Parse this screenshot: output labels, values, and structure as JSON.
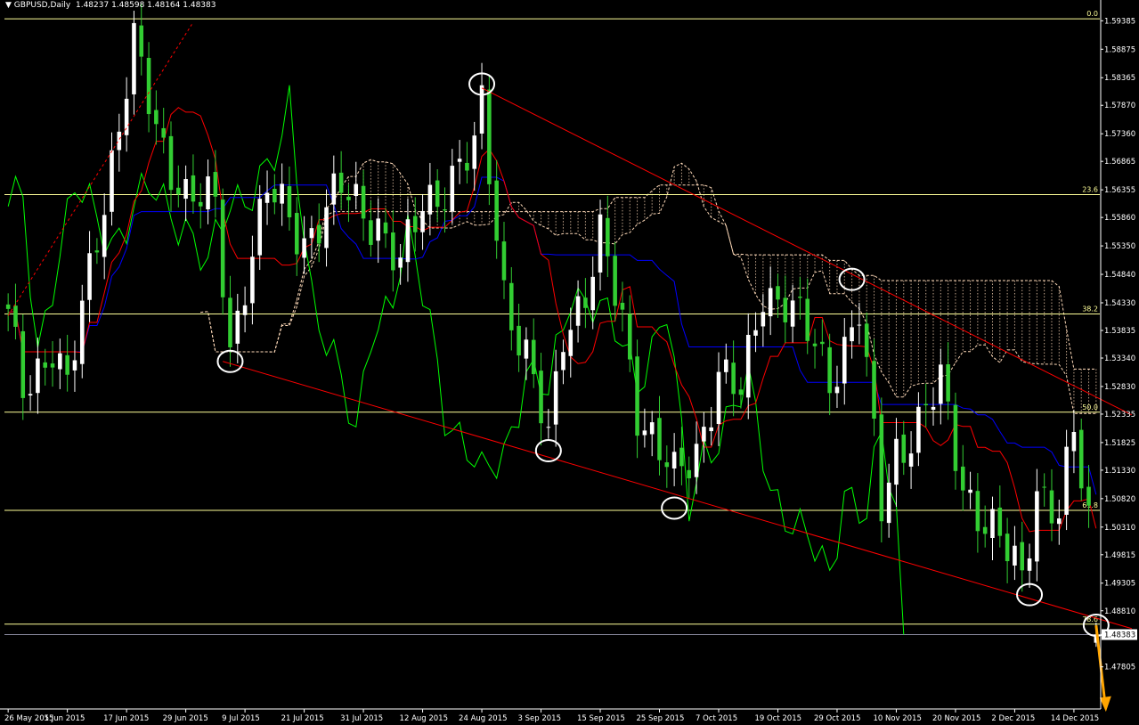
{
  "header": {
    "symbol_label": "GBPUSD,Daily",
    "ohlc": [
      "1.48237",
      "1.48598",
      "1.48164",
      "1.48383"
    ]
  },
  "chart_data": {
    "type": "candlestick",
    "ylim": [
      1.4705,
      1.5955
    ],
    "y_ticks": [
      "1.59385",
      "1.58875",
      "1.58365",
      "1.57870",
      "1.57360",
      "1.56865",
      "1.56355",
      "1.55860",
      "1.55350",
      "1.54840",
      "1.54330",
      "1.53835",
      "1.53340",
      "1.52830",
      "1.52335",
      "1.51825",
      "1.51330",
      "1.50820",
      "1.50310",
      "1.49815",
      "1.49305",
      "1.48810",
      "1.48383",
      "1.47805"
    ],
    "x_ticks": [
      "26 May 2015",
      "5 Jun 2015",
      "17 Jun 2015",
      "29 Jun 2015",
      "9 Jul 2015",
      "21 Jul 2015",
      "31 Jul 2015",
      "12 Aug 2015",
      "24 Aug 2015",
      "3 Sep 2015",
      "15 Sep 2015",
      "25 Sep 2015",
      "7 Oct 2015",
      "19 Oct 2015",
      "29 Oct 2015",
      "10 Nov 2015",
      "20 Nov 2015",
      "2 Dec 2015",
      "14 Dec 2015"
    ],
    "current_price": "1.48383",
    "fib_levels": [
      {
        "label": "0.0",
        "price": 1.5942
      },
      {
        "label": "23.6",
        "price": 1.5627
      },
      {
        "label": "38.2",
        "price": 1.5413
      },
      {
        "label": "50.0",
        "price": 1.5237
      },
      {
        "label": "61.8",
        "price": 1.5061
      },
      {
        "label": "78.6",
        "price": 1.4857
      }
    ],
    "trendlines": [
      {
        "name": "upper-channel",
        "from": [
          "24 Aug 2015",
          1.5818
        ],
        "to": [
          "22 Dec 2015",
          1.5248
        ]
      },
      {
        "name": "lower-channel",
        "from": [
          "6 Jul 2015",
          1.5328
        ],
        "to": [
          "22 Dec 2015",
          1.4857
        ]
      },
      {
        "name": "rising-dashed",
        "from": [
          "26 May 2015",
          1.541
        ],
        "to": [
          "23 Jun 2015",
          1.594
        ]
      }
    ],
    "markers": [
      {
        "date": "7 Jul 2015",
        "price": 1.5328
      },
      {
        "date": "24 Aug 2015",
        "price": 1.5825
      },
      {
        "date": "4 Sep 2015",
        "price": 1.5168
      },
      {
        "date": "29 Sep 2015",
        "price": 1.5065
      },
      {
        "date": "2 Nov 2015",
        "price": 1.5475
      },
      {
        "date": "4 Dec 2015",
        "price": 1.491
      },
      {
        "date": "21 Dec 2015",
        "price": 1.4855
      }
    ],
    "colors": {
      "background": "#000000",
      "candle_up": "#ffffff",
      "candle_down": "#32cd32",
      "tenkan": "#ff0000",
      "kijun": "#0000ff",
      "chikou": "#00ff00",
      "cloud": "#ffdab9",
      "fib": "#ffff99",
      "trendline": "#ff0000",
      "arrow": "#ffa500",
      "marker": "#ffffff"
    }
  }
}
